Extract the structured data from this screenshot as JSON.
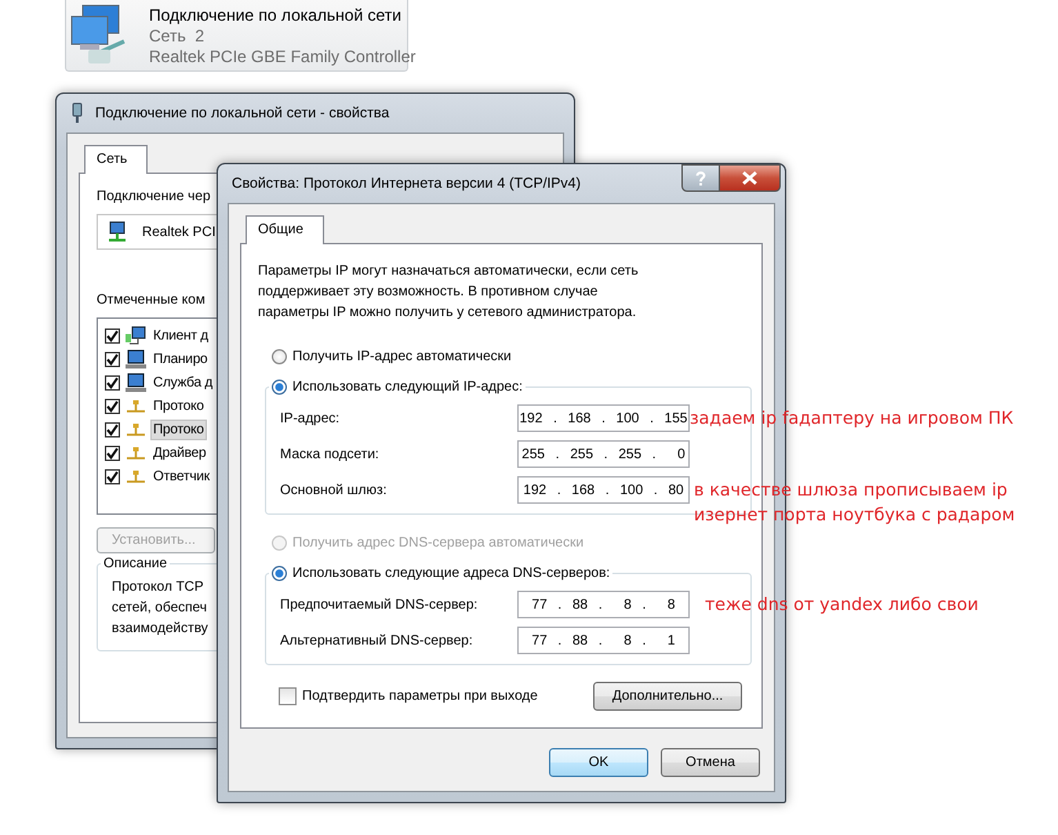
{
  "connection_tile": {
    "title": "Подключение по локальной сети",
    "network": "Сеть  2",
    "adapter": "Realtek PCIe GBE Family Controller"
  },
  "back_window": {
    "title": "Подключение по локальной сети - свойства",
    "tabs": [
      {
        "label": "Сеть",
        "selected": true
      }
    ],
    "connect_label": "Подключение чер",
    "adapter": "Realtek PCI",
    "components_label": "Отмеченные ком",
    "components": [
      {
        "label": "Клиент д",
        "kind": "client",
        "checked": true,
        "selected": false
      },
      {
        "label": "Планиро",
        "kind": "computer",
        "checked": true,
        "selected": false
      },
      {
        "label": "Служба д",
        "kind": "computer",
        "checked": true,
        "selected": false
      },
      {
        "label": "Протоко",
        "kind": "protocol",
        "checked": true,
        "selected": false
      },
      {
        "label": "Протоко",
        "kind": "protocol",
        "checked": true,
        "selected": true
      },
      {
        "label": "Драйвер",
        "kind": "protocol",
        "checked": true,
        "selected": false
      },
      {
        "label": "Ответчик",
        "kind": "protocol",
        "checked": true,
        "selected": false
      }
    ],
    "install_button": {
      "label": "Установить...",
      "disabled": true
    },
    "description": {
      "title": "Описание",
      "lines": [
        "Протокол TCP",
        "сетей, обеспеч",
        "взаимодейству"
      ]
    }
  },
  "front_window": {
    "title": "Свойства: Протокол Интернета версии 4 (TCP/IPv4)",
    "tabs": [
      {
        "label": "Общие",
        "selected": true
      }
    ],
    "intro": "Параметры IP могут назначаться автоматически, если сеть поддерживает эту возможность. В противном случае параметры IP можно получить у сетевого администратора.",
    "ip_auto": {
      "label": "Получить IP-адрес автоматически",
      "selected": false,
      "disabled": false
    },
    "ip_manual": {
      "label": "Использовать следующий IP-адрес:",
      "selected": true,
      "disabled": false
    },
    "ip_fields": [
      {
        "label": "IP-адрес:",
        "value": "192 . 168 . 100 . 155"
      },
      {
        "label": "Маска подсети:",
        "value": "255 . 255 . 255 .  0"
      },
      {
        "label": "Основной шлюз:",
        "value": "192 . 168 . 100 . 80"
      }
    ],
    "dns_auto": {
      "label": "Получить адрес DNS-сервера автоматически",
      "selected": false,
      "disabled": true
    },
    "dns_manual": {
      "label": "Использовать следующие адреса DNS-серверов:",
      "selected": true,
      "disabled": false
    },
    "dns_fields": [
      {
        "label": "Предпочитаемый DNS-сервер:",
        "value": "77 . 88 .  8 .  8"
      },
      {
        "label": "Альтернативный DNS-сервер:",
        "value": "77 . 88 .  8 .  1"
      }
    ],
    "confirm": {
      "label": "Подтвердить параметры при выходе",
      "checked": false
    },
    "advanced_button": "Дополнительно...",
    "buttons": [
      {
        "label": "OK",
        "default": true
      },
      {
        "label": "Отмена",
        "default": false
      }
    ]
  },
  "annotations": [
    {
      "text": "задаем ip fадаптеру на игровом ПК"
    },
    {
      "text": "в качестве шлюза прописываем ip\nизернет порта ноутбука с радаром"
    },
    {
      "text": "теже dns от yandex либо свои"
    }
  ]
}
